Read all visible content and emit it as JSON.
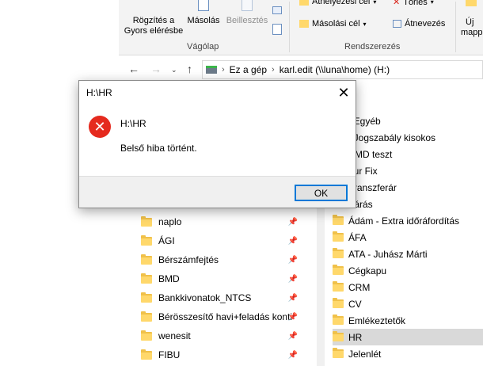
{
  "ribbon": {
    "pin_quick_access_label_line1": "Rögzítés a",
    "pin_quick_access_label_line2": "Gyors elérésbe",
    "copy_label": "Másolás",
    "paste_label": "Beillesztés",
    "clipboard_group": "Vágólap",
    "move_to_label": "Áthelyezési cél",
    "copy_to_label": "Másolási cél",
    "delete_label": "Törlés",
    "rename_label": "Átnevezés",
    "organize_group": "Rendszerezés",
    "new_folder_partial_line1": "Új",
    "new_folder_partial_line2": "mappa"
  },
  "address": {
    "crumbs": [
      "Ez a gép",
      "karl.edit (\\\\luna\\home) (H:)"
    ]
  },
  "nav_pane": {
    "items": [
      {
        "label": "naplo"
      },
      {
        "label": "ÁGI"
      },
      {
        "label": "Bérszámfejtés"
      },
      {
        "label": "BMD"
      },
      {
        "label": "Bankkivonatok_NTCS"
      },
      {
        "label": "Bérösszesítő havi+feladás konti"
      },
      {
        "label": "wenesit"
      },
      {
        "label": "FIBU"
      }
    ]
  },
  "content_pane": {
    "items": [
      {
        "label": "_Egyéb"
      },
      {
        "label": "_Jogszabály kisokos"
      },
      {
        "label": "BMD teszt"
      },
      {
        "label": "our Fix"
      },
      {
        "label": "Transzferár"
      },
      {
        "label": "Zárás"
      },
      {
        "label": "Ádám - Extra időráfordítás"
      },
      {
        "label": "ÁFA"
      },
      {
        "label": "ATA - Juhász Márti"
      },
      {
        "label": "Cégkapu"
      },
      {
        "label": "CRM"
      },
      {
        "label": "CV"
      },
      {
        "label": "Emlékeztetők"
      },
      {
        "label": "HR"
      },
      {
        "label": "Jelenlét"
      }
    ]
  },
  "dialog": {
    "title": "H:\\HR",
    "heading": "H:\\HR",
    "message": "Belső hiba történt.",
    "ok_label": "OK"
  },
  "colors": {
    "error_icon": "#e52a1e",
    "accent_border": "#0078d7",
    "folder": "#ffd86b",
    "selection": "#d9d9d9"
  }
}
